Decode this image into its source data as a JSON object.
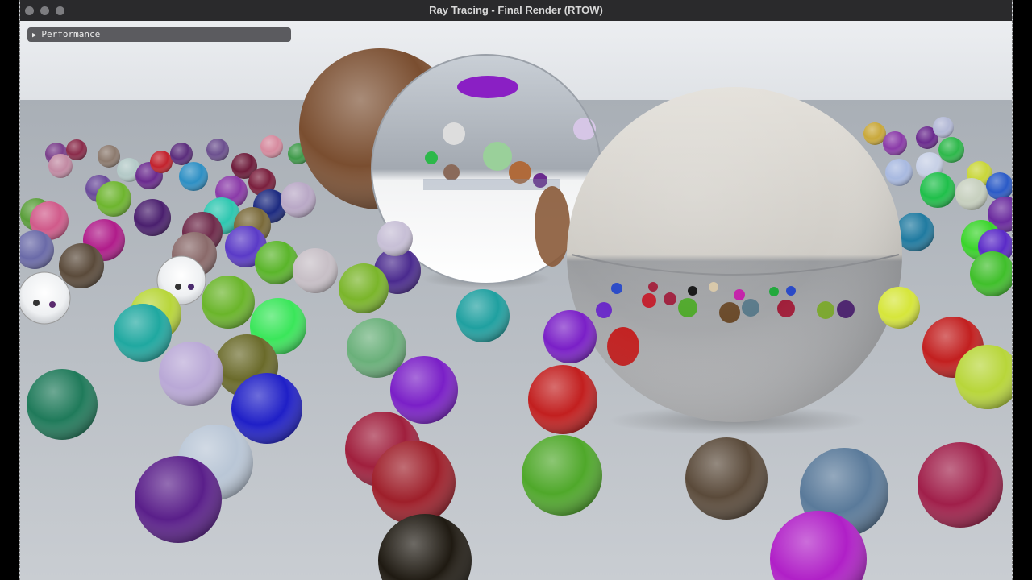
{
  "window": {
    "title": "Ray Tracing - Final Render (RTOW)"
  },
  "panel": {
    "label": "Performance",
    "collapsed": true,
    "arrow_icon": "triangle-right-icon"
  },
  "colors": {
    "titlebar": "#2a2a2c",
    "panel_bg": "#5b5b5f",
    "sky": "#e9ebee",
    "ground": "#b9bfc6"
  }
}
